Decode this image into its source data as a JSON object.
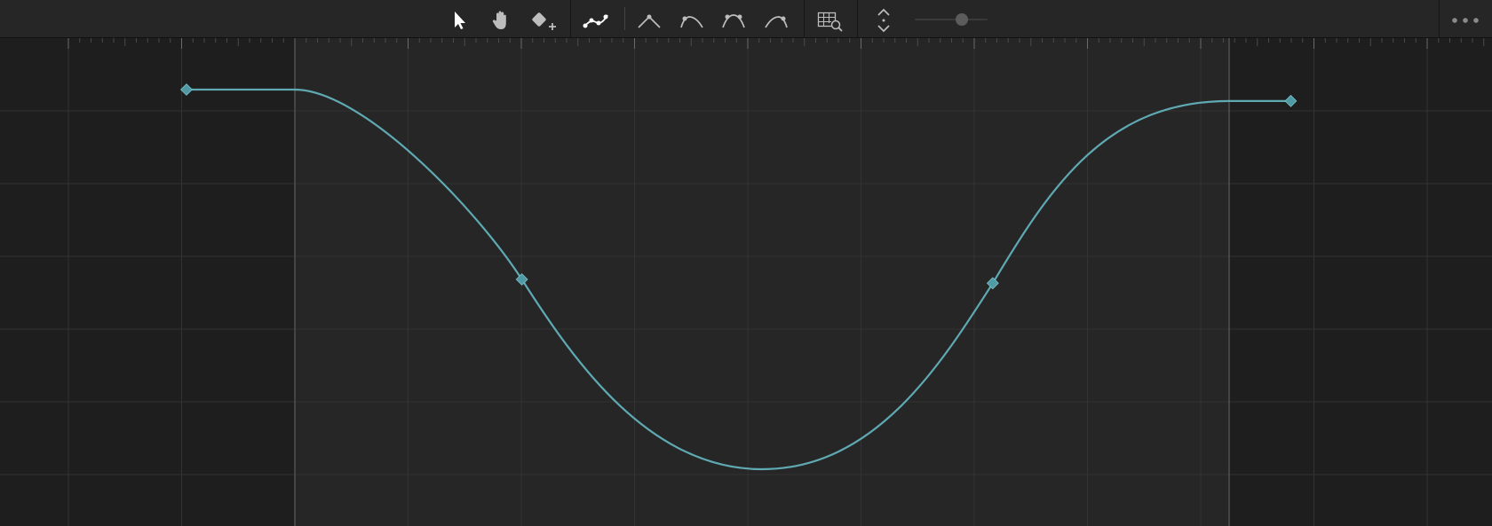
{
  "toolbar": {
    "tools": [
      {
        "name": "select-tool",
        "icon": "pointer-arrow-icon",
        "active": true
      },
      {
        "name": "pan-tool",
        "icon": "hand-icon",
        "active": false
      },
      {
        "name": "add-keyframe-tool",
        "icon": "keyframe-add-icon",
        "active": false
      },
      {
        "name": "smooth-curve-tool",
        "icon": "bezier-curve-icon",
        "active": true
      },
      {
        "name": "linear-interpolation",
        "icon": "corner-point-icon",
        "active": false
      },
      {
        "name": "ease-in-interpolation",
        "icon": "ease-in-icon",
        "active": false
      },
      {
        "name": "ease-in-out-interpolation",
        "icon": "ease-in-out-icon",
        "active": false
      },
      {
        "name": "ease-out-interpolation",
        "icon": "ease-out-icon",
        "active": false
      },
      {
        "name": "fit-to-view",
        "icon": "grid-zoom-icon",
        "active": false
      },
      {
        "name": "vertical-fit",
        "icon": "expand-vertical-icon",
        "active": false
      }
    ],
    "zoom": {
      "value": 0.65
    },
    "more_icon": "ellipsis-icon"
  },
  "colors": {
    "curve": "#5fa9b2",
    "keyframe": "#4f9aa5",
    "background_inner": "#262626",
    "background_outer": "#1e1e1e",
    "grid": "#333333",
    "icon": "#bdbdbd",
    "icon_active": "#ffffff"
  },
  "curve": {
    "range": {
      "start": 0.0,
      "end": 1.0
    },
    "keyframes": [
      {
        "t": -0.116,
        "v": 1.0
      },
      {
        "t": 0.243,
        "v": 0.5
      },
      {
        "t": 0.747,
        "v": 0.49
      },
      {
        "t": 1.066,
        "v": 0.97
      }
    ],
    "control_points": [
      {
        "t": -0.116,
        "v": 1.0
      },
      {
        "t": 0.0,
        "v": 1.0
      },
      {
        "t": 0.07,
        "v": 1.0
      },
      {
        "t": 0.19,
        "v": 0.7
      },
      {
        "t": 0.243,
        "v": 0.5
      },
      {
        "t": 0.3,
        "v": 0.28
      },
      {
        "t": 0.38,
        "v": 0.0
      },
      {
        "t": 0.5,
        "v": 0.0
      },
      {
        "t": 0.62,
        "v": 0.0
      },
      {
        "t": 0.69,
        "v": 0.27
      },
      {
        "t": 0.747,
        "v": 0.49
      },
      {
        "t": 0.81,
        "v": 0.75
      },
      {
        "t": 0.87,
        "v": 0.97
      },
      {
        "t": 1.0,
        "v": 0.97
      },
      {
        "t": 1.066,
        "v": 0.97
      }
    ]
  }
}
